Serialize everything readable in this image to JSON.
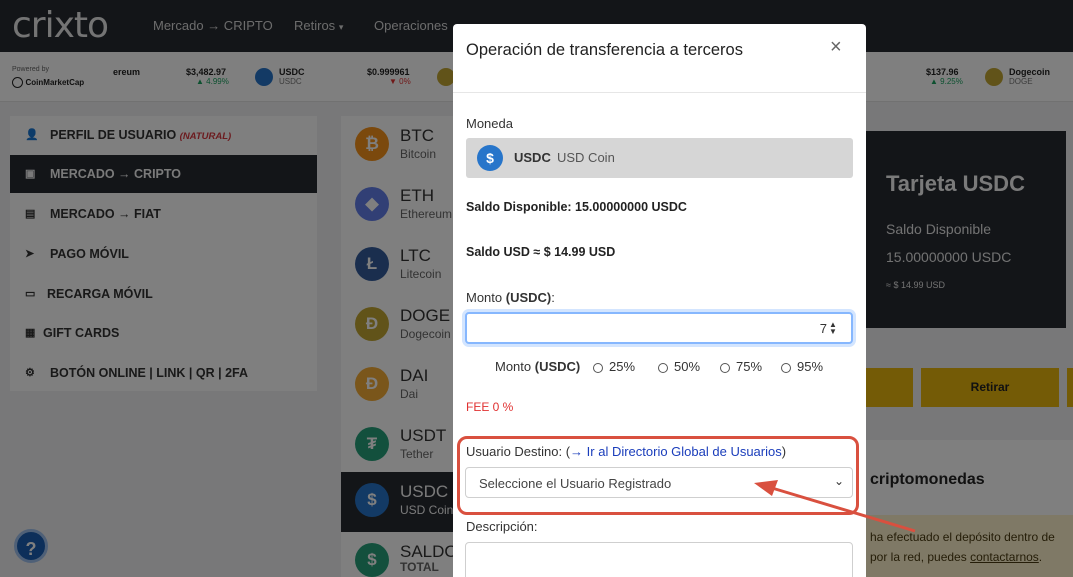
{
  "nav": {
    "logo": "crixto",
    "items": [
      "Mercado → CRIPTO",
      "Retiros",
      "Operaciones"
    ]
  },
  "ticker": {
    "powered_by": "Powered by",
    "provider": "CoinMarketCap",
    "items": [
      {
        "label": "ereum"
      },
      {
        "price": "$3,482.97",
        "change": "▲ 4.99%",
        "dir": "up"
      },
      {
        "symbol": "USDC",
        "name": "USDC"
      },
      {
        "price": "$0.999961",
        "change": "▼ 0%",
        "dir": "down"
      },
      {
        "price": "$137.96",
        "change": "▲ 9.25%",
        "dir": "up"
      },
      {
        "symbol": "Dogecoin",
        "name": "DOGE"
      }
    ]
  },
  "sidebar": {
    "items": [
      {
        "icon": "user-icon",
        "label": "PERFIL DE USUARIO",
        "tag": "(NATURAL)"
      },
      {
        "icon": "wallet-icon",
        "label": "MERCADO → CRIPTO",
        "active": true
      },
      {
        "icon": "money-icon",
        "label": "MERCADO → FIAT"
      },
      {
        "icon": "send-icon",
        "label": "PAGO MÓVIL"
      },
      {
        "icon": "card-icon",
        "label": "RECARGA MÓVIL"
      },
      {
        "icon": "gift-icon",
        "label": "GIFT CARDS"
      },
      {
        "icon": "gear-icon",
        "label": "BOTÓN ONLINE | LINK | QR | 2FA"
      }
    ]
  },
  "coins": [
    {
      "symbol": "BTC",
      "name": "Bitcoin",
      "color": "#f7931a",
      "glyph": "₿"
    },
    {
      "symbol": "ETH",
      "name": "Ethereum",
      "color": "#627eea",
      "glyph": "◆"
    },
    {
      "symbol": "LTC",
      "name": "Litecoin",
      "color": "#345d9d",
      "glyph": "Ł"
    },
    {
      "symbol": "DOGE",
      "name": "Dogecoin",
      "color": "#c2a633",
      "glyph": "Ð"
    },
    {
      "symbol": "DAI",
      "name": "Dai",
      "color": "#f5ac37",
      "glyph": "Ð"
    },
    {
      "symbol": "USDT",
      "name": "Tether",
      "color": "#26a17b",
      "glyph": "₮"
    },
    {
      "symbol": "USDC",
      "name": "USD Coin",
      "color": "#2775ca",
      "glyph": "$",
      "active": true
    },
    {
      "symbol": "SALDO",
      "name": "TOTAL",
      "color": "#26a17b",
      "glyph": "$"
    }
  ],
  "card": {
    "title": "Tarjeta USDC",
    "available_label": "Saldo Disponible",
    "available": "15.00000000 USDC",
    "usd": "≈ $ 14.99 USD"
  },
  "buttons": {
    "withdraw": "Retirar"
  },
  "right_panel": {
    "heading": "criptomonedas",
    "notice_1": "ha efectuado el depósito dentro de",
    "notice_2": "por la red, puedes",
    "notice_link": "contactarnos"
  },
  "modal": {
    "title": "Operación de transferencia a terceros",
    "close": "×",
    "currency_label": "Moneda",
    "currency_symbol": "USDC",
    "currency_name": "USD Coin",
    "balance": "Saldo Disponible: 15.00000000 USDC",
    "balance_usd": "Saldo USD ≈ $ 14.99 USD",
    "amount_label": "Monto",
    "amount_unit": "(USDC)",
    "amount_value": "7",
    "pct_label": "Monto",
    "pct_options": [
      "25%",
      "50%",
      "75%",
      "95%"
    ],
    "fee": "FEE 0 %",
    "dest_label": "Usuario Destino: (",
    "dest_link": "→ Ir al Directorio Global de Usuarios",
    "dest_close": ")",
    "dest_select": "Seleccione el Usuario Registrado",
    "desc_label": "Descripción:"
  },
  "colors": {
    "nav": "#262a31",
    "accent_yellow": "#e8b70c",
    "annotation": "#d9503f",
    "fee": "#e03131"
  }
}
